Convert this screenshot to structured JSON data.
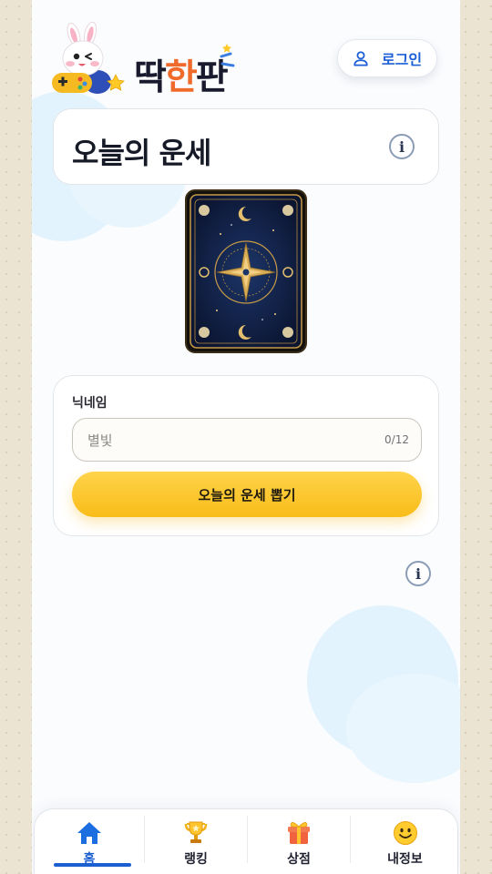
{
  "header": {
    "logo": {
      "part1": "딱",
      "part2": "한",
      "part3": "판"
    },
    "login_label": "로그인"
  },
  "main": {
    "title": "오늘의 운세",
    "form": {
      "nickname_label": "닉네임",
      "nickname_placeholder": "별빛",
      "nickname_value": "",
      "char_count": "0/12",
      "draw_button_label": "오늘의 운세 뽑기"
    }
  },
  "nav": {
    "items": [
      {
        "label": "홈",
        "icon": "home-icon",
        "active": true
      },
      {
        "label": "랭킹",
        "icon": "trophy-icon",
        "active": false
      },
      {
        "label": "상점",
        "icon": "gift-icon",
        "active": false
      },
      {
        "label": "내정보",
        "icon": "smiley-icon",
        "active": false
      }
    ]
  },
  "colors": {
    "accent": "#1c5fd1",
    "button_yellow": "#fcc52a",
    "logo_orange": "#f06a2b",
    "page_bg": "#ece4d3"
  }
}
